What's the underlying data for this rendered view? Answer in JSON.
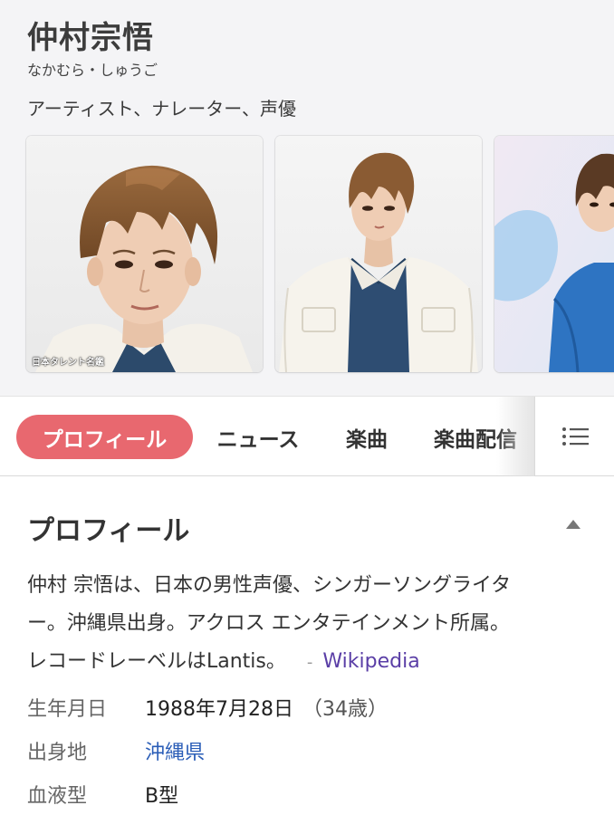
{
  "header": {
    "name": "仲村宗悟",
    "reading": "なかむら・しゅうご",
    "occupation": "アーティスト、ナレーター、声優"
  },
  "photos": [
    {
      "credit": "日本タレント名鑑"
    }
  ],
  "tabs": [
    {
      "label": "プロフィール",
      "active": true
    },
    {
      "label": "ニュース",
      "active": false
    },
    {
      "label": "楽曲",
      "active": false
    },
    {
      "label": "楽曲配信",
      "active": false
    }
  ],
  "icons": {
    "more": "list-menu-icon",
    "collapse": "triangle-up-icon"
  },
  "colors": {
    "active_tab": "#e8686f",
    "wikipedia_link": "#5a3ea6",
    "birthplace_link": "#2a5db7"
  },
  "profile": {
    "title": "プロフィール",
    "description_line1": "仲村 宗悟は、日本の男性声優、シンガーソングライタ",
    "description_line2": "ー。沖縄県出身。アクロス エンタテインメント所属。",
    "description_line3": "レコードレーベルはLantis。",
    "source_sep": "-",
    "source": "Wikipedia",
    "facts": {
      "birthdate": {
        "label": "生年月日",
        "value": "1988年7月28日",
        "age": "（34歳）"
      },
      "birthplace": {
        "label": "出身地",
        "value": "沖縄県"
      },
      "blood_type": {
        "label": "血液型",
        "value": "B型"
      }
    }
  }
}
